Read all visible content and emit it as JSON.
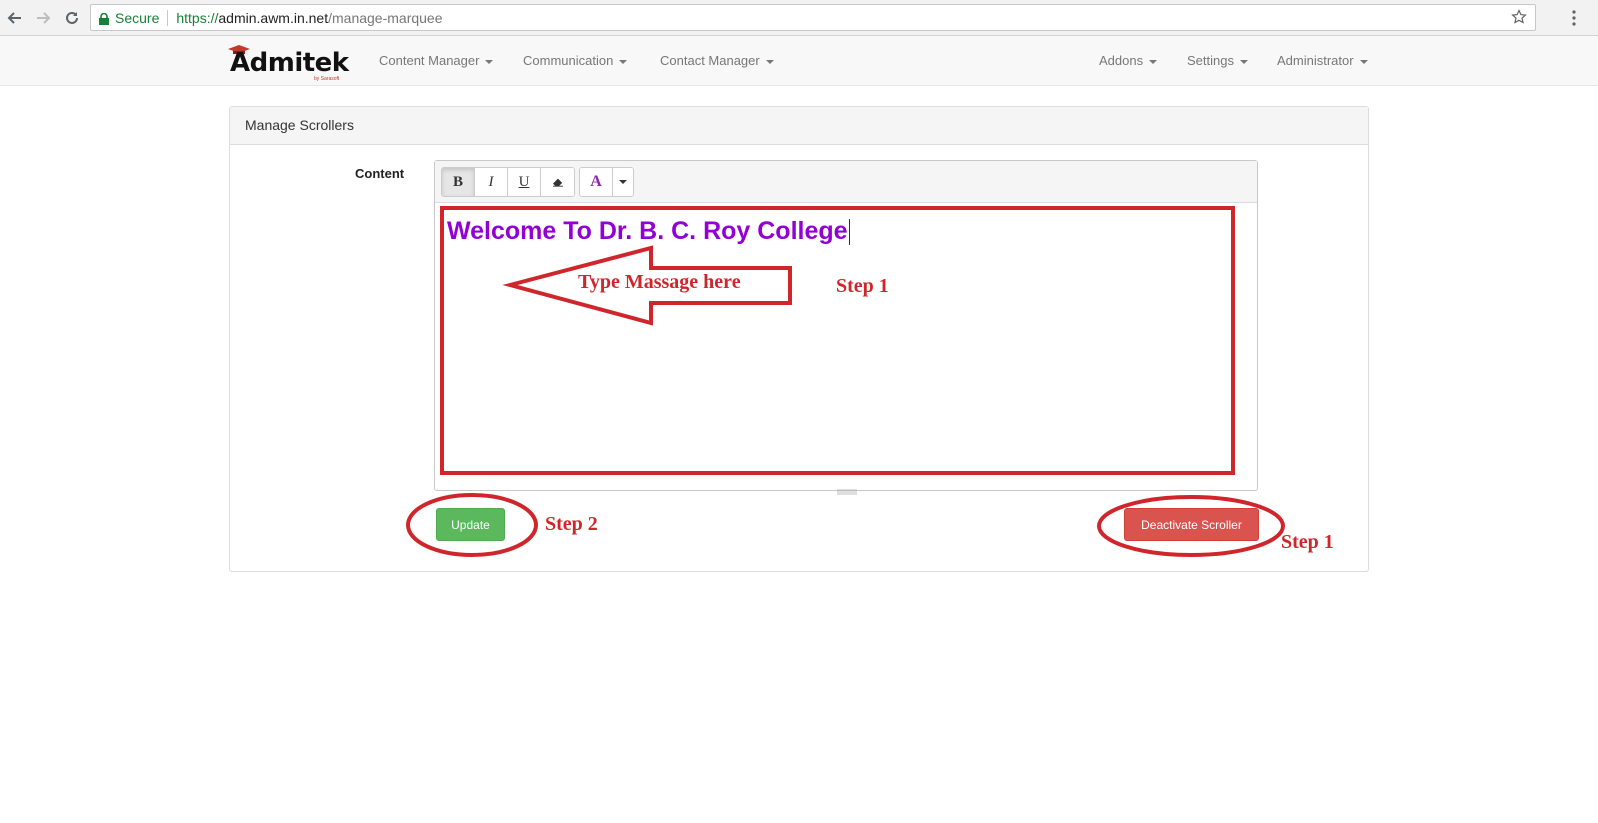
{
  "browser": {
    "secure_label": "Secure",
    "url_scheme": "https://",
    "url_host": "admin.awm.in.net",
    "url_path": "/manage-marquee"
  },
  "navbar": {
    "brand": "Admitek",
    "brand_sub": "by Sarasoft",
    "left_items": [
      {
        "label": "Content Manager"
      },
      {
        "label": "Communication"
      },
      {
        "label": "Contact Manager"
      }
    ],
    "right_items": [
      {
        "label": "Addons"
      },
      {
        "label": "Settings"
      },
      {
        "label": "Administrator"
      }
    ]
  },
  "panel": {
    "title": "Manage Scrollers",
    "content_label": "Content"
  },
  "editor": {
    "toolbar": {
      "bold": "B",
      "italic": "I",
      "underline": "U",
      "color_letter": "A"
    },
    "text": "Welcome To Dr. B. C. Roy College",
    "text_color": "#9400d3"
  },
  "buttons": {
    "update": "Update",
    "deactivate": "Deactivate Scroller"
  },
  "annotations": {
    "arrow_label": "Type Massage here",
    "step_editor": "Step 1",
    "step_update": "Step 2",
    "step_deactivate": "Step 1",
    "color": "#d0262b"
  },
  "icons": [
    "back-icon",
    "forward-icon",
    "reload-icon",
    "lock-icon",
    "star-icon",
    "menu-icon",
    "eraser-icon",
    "caret-icon"
  ]
}
